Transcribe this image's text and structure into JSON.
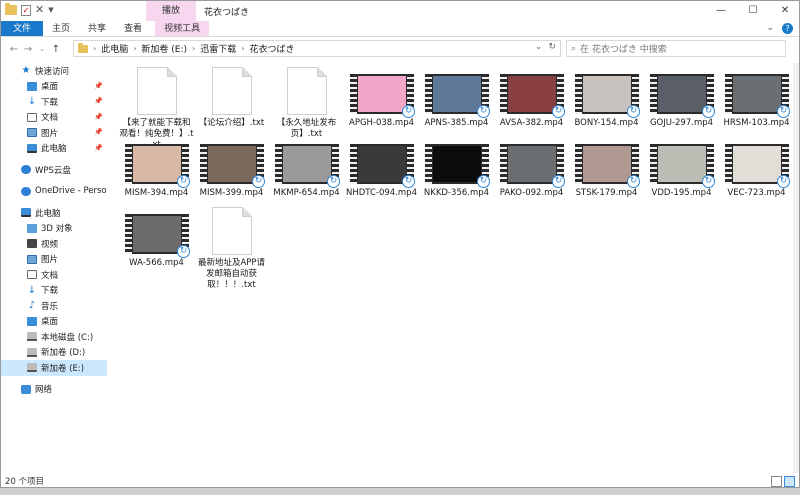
{
  "window": {
    "title": "花衣つばき",
    "context_tab": "播放"
  },
  "ribbon": {
    "tabs": [
      "文件",
      "主页",
      "共享",
      "查看",
      "视频工具"
    ]
  },
  "address": {
    "crumbs": [
      "此电脑",
      "新加卷 (E:)",
      "迅雷下载",
      "花衣つばき"
    ],
    "search_placeholder": "在 花衣つばき 中搜索"
  },
  "sidebar": {
    "items": [
      {
        "label": "快速访问",
        "icon": "star",
        "sub": false,
        "pin": false
      },
      {
        "label": "桌面",
        "icon": "blue",
        "sub": true,
        "pin": true
      },
      {
        "label": "下载",
        "icon": "down",
        "sub": true,
        "pin": true
      },
      {
        "label": "文档",
        "icon": "doc",
        "sub": true,
        "pin": true
      },
      {
        "label": "图片",
        "icon": "img",
        "sub": true,
        "pin": true
      },
      {
        "label": "此电脑",
        "icon": "pc",
        "sub": true,
        "pin": true
      },
      {
        "label": "",
        "icon": "",
        "gap": true
      },
      {
        "label": "WPS云盘",
        "icon": "cloud",
        "sub": false,
        "pin": false
      },
      {
        "label": "",
        "icon": "",
        "gap": true
      },
      {
        "label": "OneDrive - Persona",
        "icon": "cloud",
        "sub": false,
        "pin": false
      },
      {
        "label": "",
        "icon": "",
        "gap": true
      },
      {
        "label": "此电脑",
        "icon": "pc",
        "sub": false,
        "pin": false
      },
      {
        "label": "3D 对象",
        "icon": "cube",
        "sub": true,
        "pin": false
      },
      {
        "label": "视频",
        "icon": "film",
        "sub": true,
        "pin": false
      },
      {
        "label": "图片",
        "icon": "img",
        "sub": true,
        "pin": false
      },
      {
        "label": "文档",
        "icon": "doc",
        "sub": true,
        "pin": false
      },
      {
        "label": "下载",
        "icon": "down",
        "sub": true,
        "pin": false
      },
      {
        "label": "音乐",
        "icon": "music",
        "sub": true,
        "pin": false
      },
      {
        "label": "桌面",
        "icon": "blue",
        "sub": true,
        "pin": false
      },
      {
        "label": "本地磁盘 (C:)",
        "icon": "drive",
        "sub": true,
        "pin": false
      },
      {
        "label": "新加卷 (D:)",
        "icon": "drive",
        "sub": true,
        "pin": false
      },
      {
        "label": "新加卷 (E:)",
        "icon": "drive",
        "sub": true,
        "pin": false,
        "selected": true
      },
      {
        "label": "",
        "icon": "",
        "gap": true
      },
      {
        "label": "网络",
        "icon": "net",
        "sub": false,
        "pin": false
      }
    ]
  },
  "files": [
    {
      "name": "【来了就能下载和观看！纯免费！】.txt",
      "type": "txt"
    },
    {
      "name": "【论坛介绍】.txt",
      "type": "txt"
    },
    {
      "name": "【永久地址发布页】.txt",
      "type": "txt"
    },
    {
      "name": "APGH-038.mp4",
      "type": "mp4",
      "tone": "#f3a7c8"
    },
    {
      "name": "APNS-385.mp4",
      "type": "mp4",
      "tone": "#5d7898"
    },
    {
      "name": "AVSA-382.mp4",
      "type": "mp4",
      "tone": "#8a4040"
    },
    {
      "name": "BONY-154.mp4",
      "type": "mp4",
      "tone": "#c8c2bf"
    },
    {
      "name": "GOJU-297.mp4",
      "type": "mp4",
      "tone": "#5a5f67"
    },
    {
      "name": "HRSM-103.mp4",
      "type": "mp4",
      "tone": "#6a6f73"
    },
    {
      "name": "MISM-394.mp4",
      "type": "mp4",
      "tone": "#d8b8a6"
    },
    {
      "name": "MISM-399.mp4",
      "type": "mp4",
      "tone": "#7c6a5e"
    },
    {
      "name": "MKMP-654.mp4",
      "type": "mp4",
      "tone": "#9a9a9a"
    },
    {
      "name": "NHDTC-094.mp4",
      "type": "mp4",
      "tone": "#3a3a3a"
    },
    {
      "name": "NKKD-356.mp4",
      "type": "mp4",
      "tone": "#0c0c0c"
    },
    {
      "name": "PAKO-092.mp4",
      "type": "mp4",
      "tone": "#6b6f72"
    },
    {
      "name": "STSK-179.mp4",
      "type": "mp4",
      "tone": "#b09990"
    },
    {
      "name": "VDD-195.mp4",
      "type": "mp4",
      "tone": "#b9bdb4"
    },
    {
      "name": "VEC-723.mp4",
      "type": "mp4",
      "tone": "#e3ddd8"
    },
    {
      "name": "WA-566.mp4",
      "type": "mp4",
      "tone": "#6c6a6a"
    },
    {
      "name": "最新地址及APP请发邮箱自动获取！！！.txt",
      "type": "txt"
    }
  ],
  "status": {
    "count": "20 个项目"
  }
}
